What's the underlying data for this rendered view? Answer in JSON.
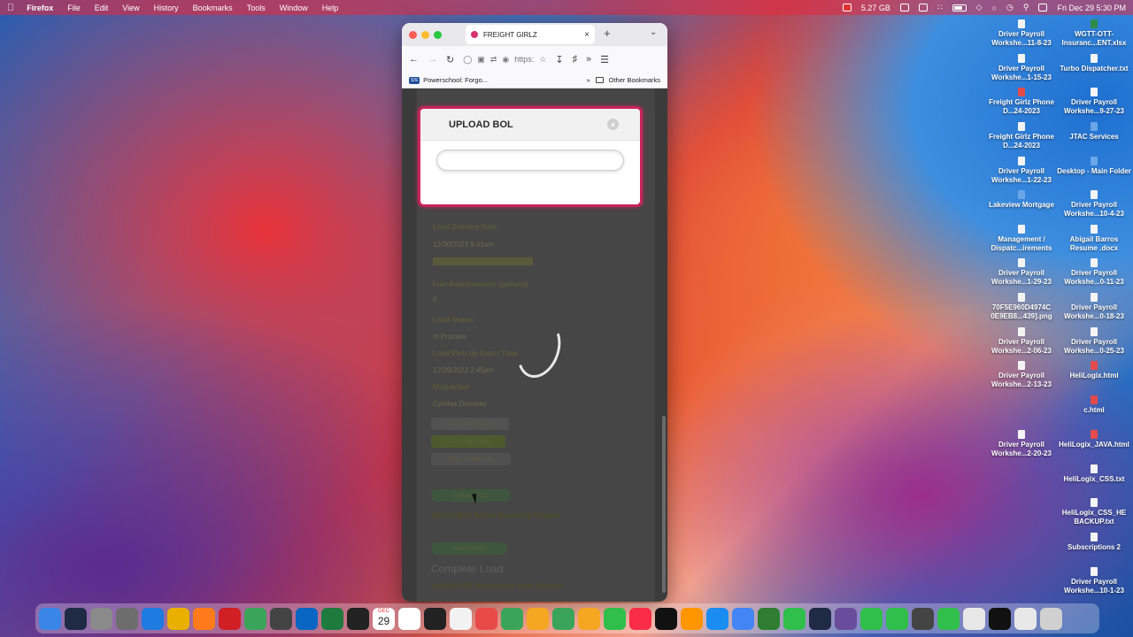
{
  "menubar": {
    "apple": "",
    "app_name": "Firefox",
    "menus": [
      "File",
      "Edit",
      "View",
      "History",
      "Bookmarks",
      "Tools",
      "Window",
      "Help"
    ],
    "storage": "5.27 GB",
    "clock": "Fri Dec 29  5:30 PM"
  },
  "browser": {
    "tab_title": "FREIGHT GIRLZ",
    "url_fragment": "https:",
    "bookmark_1": "Powerschool: Forgo...",
    "bookmark_1_badge": "SIS",
    "other_bookmarks": "Other Bookmarks"
  },
  "modal": {
    "title": "UPLOAD BOL",
    "close_glyph": "×"
  },
  "page": {
    "fields": [
      {
        "text": "Load Delivery Date",
        "type": "lbl"
      },
      {
        "text": "12/30/2023 9:41am",
        "type": "val"
      },
      {
        "text": "Driver Delivery Reference No.",
        "type": "hl"
      },
      {
        "text": "Fuel Requirements (gallons)",
        "type": "lbl"
      },
      {
        "text": "0",
        "type": "val"
      },
      {
        "text": "Load Status",
        "type": "lbl"
      },
      {
        "text": "In Process",
        "type": "val"
      },
      {
        "text": "Load Pick-Up Date / Time",
        "type": "lbl"
      },
      {
        "text": "12/29/2023 2:45pm",
        "type": "val"
      },
      {
        "text": "Dispatcher",
        "type": "lbl"
      },
      {
        "text": "Cynthia Dominey",
        "type": "val"
      }
    ],
    "buttons": {
      "text_eta": "Text ETA Update",
      "load_map": "Load Map View",
      "shop_contact": "Shop Contact Dr.",
      "upload_bol": "Upload BOL",
      "upload_pod": "Upload POD"
    },
    "note_bol": "Upload BOL Before Departing Shipper",
    "complete_load": "Complete Load",
    "note_pod": "Upload POD Immediately After Delivery"
  },
  "desktop_icons": [
    {
      "label": "Driver Payroll Workshe...11-8-23"
    },
    {
      "label": "WGTT-OTT-Insuranc...ENT.xlsx"
    },
    {
      "label": "Driver Payroll Workshe...1-15-23"
    },
    {
      "label": "Turbo Dispatcher.txt"
    },
    {
      "label": "Freight Girlz Phone D...24-2023"
    },
    {
      "label": "Driver Payroll Workshe...9-27-23"
    },
    {
      "label": "Freight Girlz Phone D...24-2023"
    },
    {
      "label": "JTAC Services"
    },
    {
      "label": "Driver Payroll Workshe...1-22-23"
    },
    {
      "label": "Desktop - Main Folder"
    },
    {
      "label": "Lakeview Mortgage"
    },
    {
      "label": "Driver Payroll Workshe...10-4-23"
    },
    {
      "label": "Management / Dispatc...irements"
    },
    {
      "label": "Abigail Barros Resume .docx"
    },
    {
      "label": "Driver Payroll Workshe...1-29-23"
    },
    {
      "label": "Driver Payroll Workshe...0-11-23"
    },
    {
      "label": "70F5E960D4974C 0E9EB8...439].png"
    },
    {
      "label": "Driver Payroll Workshe...0-18-23"
    },
    {
      "label": "Driver Payroll Workshe...2-06-23"
    },
    {
      "label": "Driver Payroll Workshe...0-25-23"
    },
    {
      "label": "Driver Payroll Workshe...2-13-23"
    },
    {
      "label": "HeliLogix.html"
    },
    {
      "label": "c.html"
    },
    {
      "label": "Driver Payroll Workshe...2-20-23"
    },
    {
      "label": "HeliLogix_JAVA.html"
    },
    {
      "label": "HeliLogix_CSS.txt"
    },
    {
      "label": "HeliLogix_CSS_HE BACKUP.txt"
    },
    {
      "label": "Subscriptions 2"
    },
    {
      "label": "Driver Payroll Workshe...10-1-23"
    }
  ],
  "dock": {
    "calendar_day": "29",
    "calendar_month": "DEC",
    "colors": [
      "#3a86e8",
      "#1f2a44",
      "#8a8a8a",
      "#6d6d6d",
      "#1e7be0",
      "#e9b000",
      "#ff7a1a",
      "#d11f26",
      "#3aa55a",
      "#444",
      "#0a66c2",
      "#1f7a3e",
      "#222",
      "#1e4e9a",
      "#ffffff",
      "#222",
      "#f2f2f2",
      "#e84a4a",
      "#3aa55a",
      "#f5a623",
      "#3aa55a",
      "#f5a623",
      "#2fbf4a",
      "#fa2d48",
      "#111",
      "#ff9500",
      "#1b8df2",
      "#4285f4",
      "#2e7d32",
      "#2fbf4a",
      "#1f2a44",
      "#6a4c9c",
      "#2fbf4a",
      "#2fbf4a",
      "#444",
      "#2fbf4a",
      "#e8e8e8",
      "#111",
      "#e8e8e8",
      "#d0d0d0"
    ]
  }
}
